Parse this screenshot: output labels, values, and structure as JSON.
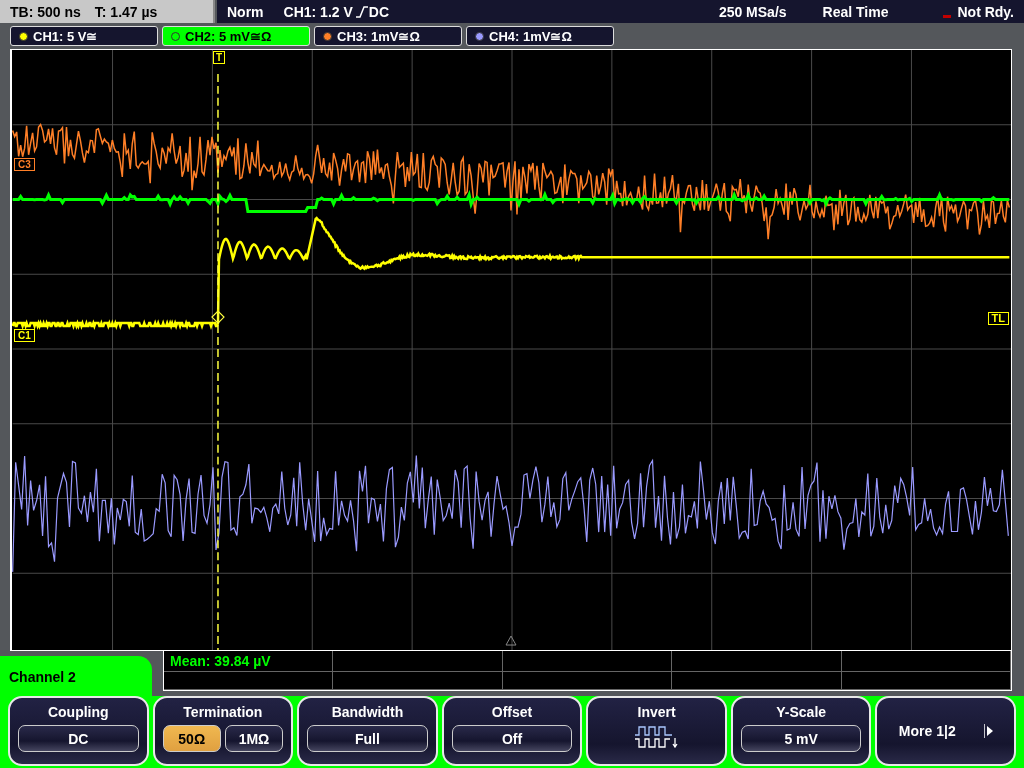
{
  "status_bar": {
    "timebase": "TB: 500 ns",
    "trigger_time": "T: 1.47 µs",
    "mode": "Norm",
    "trigger_source": "CH1: 1.2 V",
    "trigger_coupling": "DC",
    "sample_rate": "250 MSa/s",
    "acquisition": "Real Time",
    "state": "Not Rdy."
  },
  "channel_tabs": [
    {
      "label": "CH1: 5 V≅",
      "color": "#ffff00",
      "selected": false
    },
    {
      "label": "CH2: 5 mV≅Ω",
      "color": "#00ff00",
      "selected": true
    },
    {
      "label": "CH3: 1mV≅Ω",
      "color": "#ff7f27",
      "selected": false
    },
    {
      "label": "CH4: 1mV≅Ω",
      "color": "#9a9aff",
      "selected": false
    }
  ],
  "display": {
    "trigger_marker": "T",
    "trigger_level_marker": "TL",
    "channel_markers": [
      "C3",
      "C1"
    ]
  },
  "measurement": {
    "text": "Mean: 39.84 µV"
  },
  "menu": {
    "title": "Channel 2",
    "softkeys": [
      {
        "label": "Coupling",
        "kind": "value",
        "value": "DC"
      },
      {
        "label": "Termination",
        "kind": "choice",
        "options": [
          {
            "text": "50Ω",
            "selected": true
          },
          {
            "text": "1MΩ",
            "selected": false
          }
        ]
      },
      {
        "label": "Bandwidth",
        "kind": "value",
        "value": "Full"
      },
      {
        "label": "Offset",
        "kind": "value",
        "value": "Off"
      },
      {
        "label": "Invert",
        "kind": "icon"
      },
      {
        "label": "Y-Scale",
        "kind": "value",
        "value": "5 mV"
      },
      {
        "label": "More 1|2",
        "kind": "more"
      }
    ]
  }
}
